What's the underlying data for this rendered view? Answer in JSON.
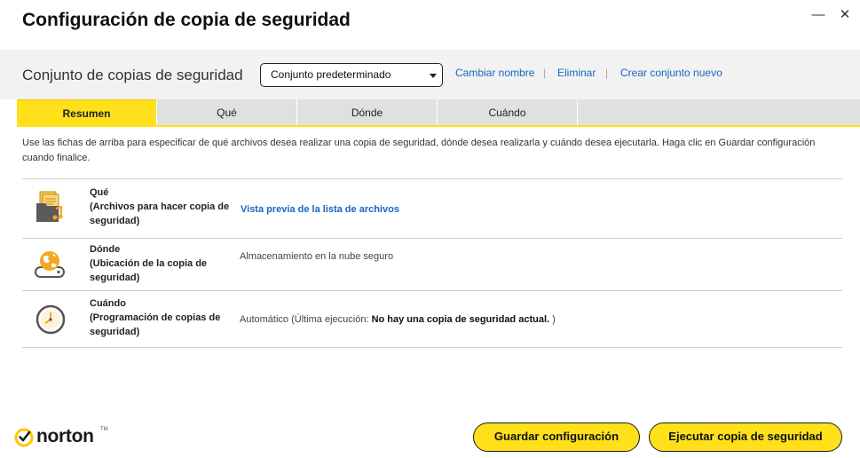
{
  "window": {
    "title": "Configuración de copia de seguridad",
    "minimize_glyph": "—",
    "close_glyph": "✕"
  },
  "backup_set": {
    "label": "Conjunto de copias de seguridad",
    "selected": "Conjunto predeterminado",
    "links": {
      "rename": "Cambiar nombre",
      "delete": "Eliminar",
      "create": "Crear conjunto nuevo"
    }
  },
  "tabs": [
    {
      "label": "Resumen",
      "active": true
    },
    {
      "label": "Qué",
      "active": false
    },
    {
      "label": "Dónde",
      "active": false
    },
    {
      "label": "Cuándo",
      "active": false
    }
  ],
  "intro_text": "Use las fichas de arriba para especificar de qué archivos desea realizar una copia de seguridad, dónde desea realizarla y cuándo desea ejecutarla. Haga clic en Guardar configuración cuando finalice.",
  "rows": {
    "what": {
      "icon": "files-folder-icon",
      "title": "Qué",
      "subtitle": "(Archivos para hacer copia de seguridad)",
      "link": "Vista previa de la lista de archivos"
    },
    "where": {
      "icon": "cloud-drive-globe-icon",
      "title": "Dónde",
      "subtitle": "(Ubicación de la copia de seguridad)",
      "value": "Almacenamiento en la nube seguro"
    },
    "when": {
      "icon": "clock-icon",
      "title": "Cuándo",
      "subtitle": "(Programación de copias de seguridad)",
      "value_prefix": "Automático (Última ejecución: ",
      "value_bold": "No hay una copia de seguridad actual.",
      "value_suffix": " )"
    }
  },
  "footer": {
    "brand": "norton",
    "brand_mark": "TM",
    "save_button": "Guardar configuración",
    "run_button": "Ejecutar copia de seguridad"
  },
  "colors": {
    "accent_yellow": "#ffe01a",
    "link_blue": "#1766c2",
    "icon_orange": "#f5a623"
  }
}
